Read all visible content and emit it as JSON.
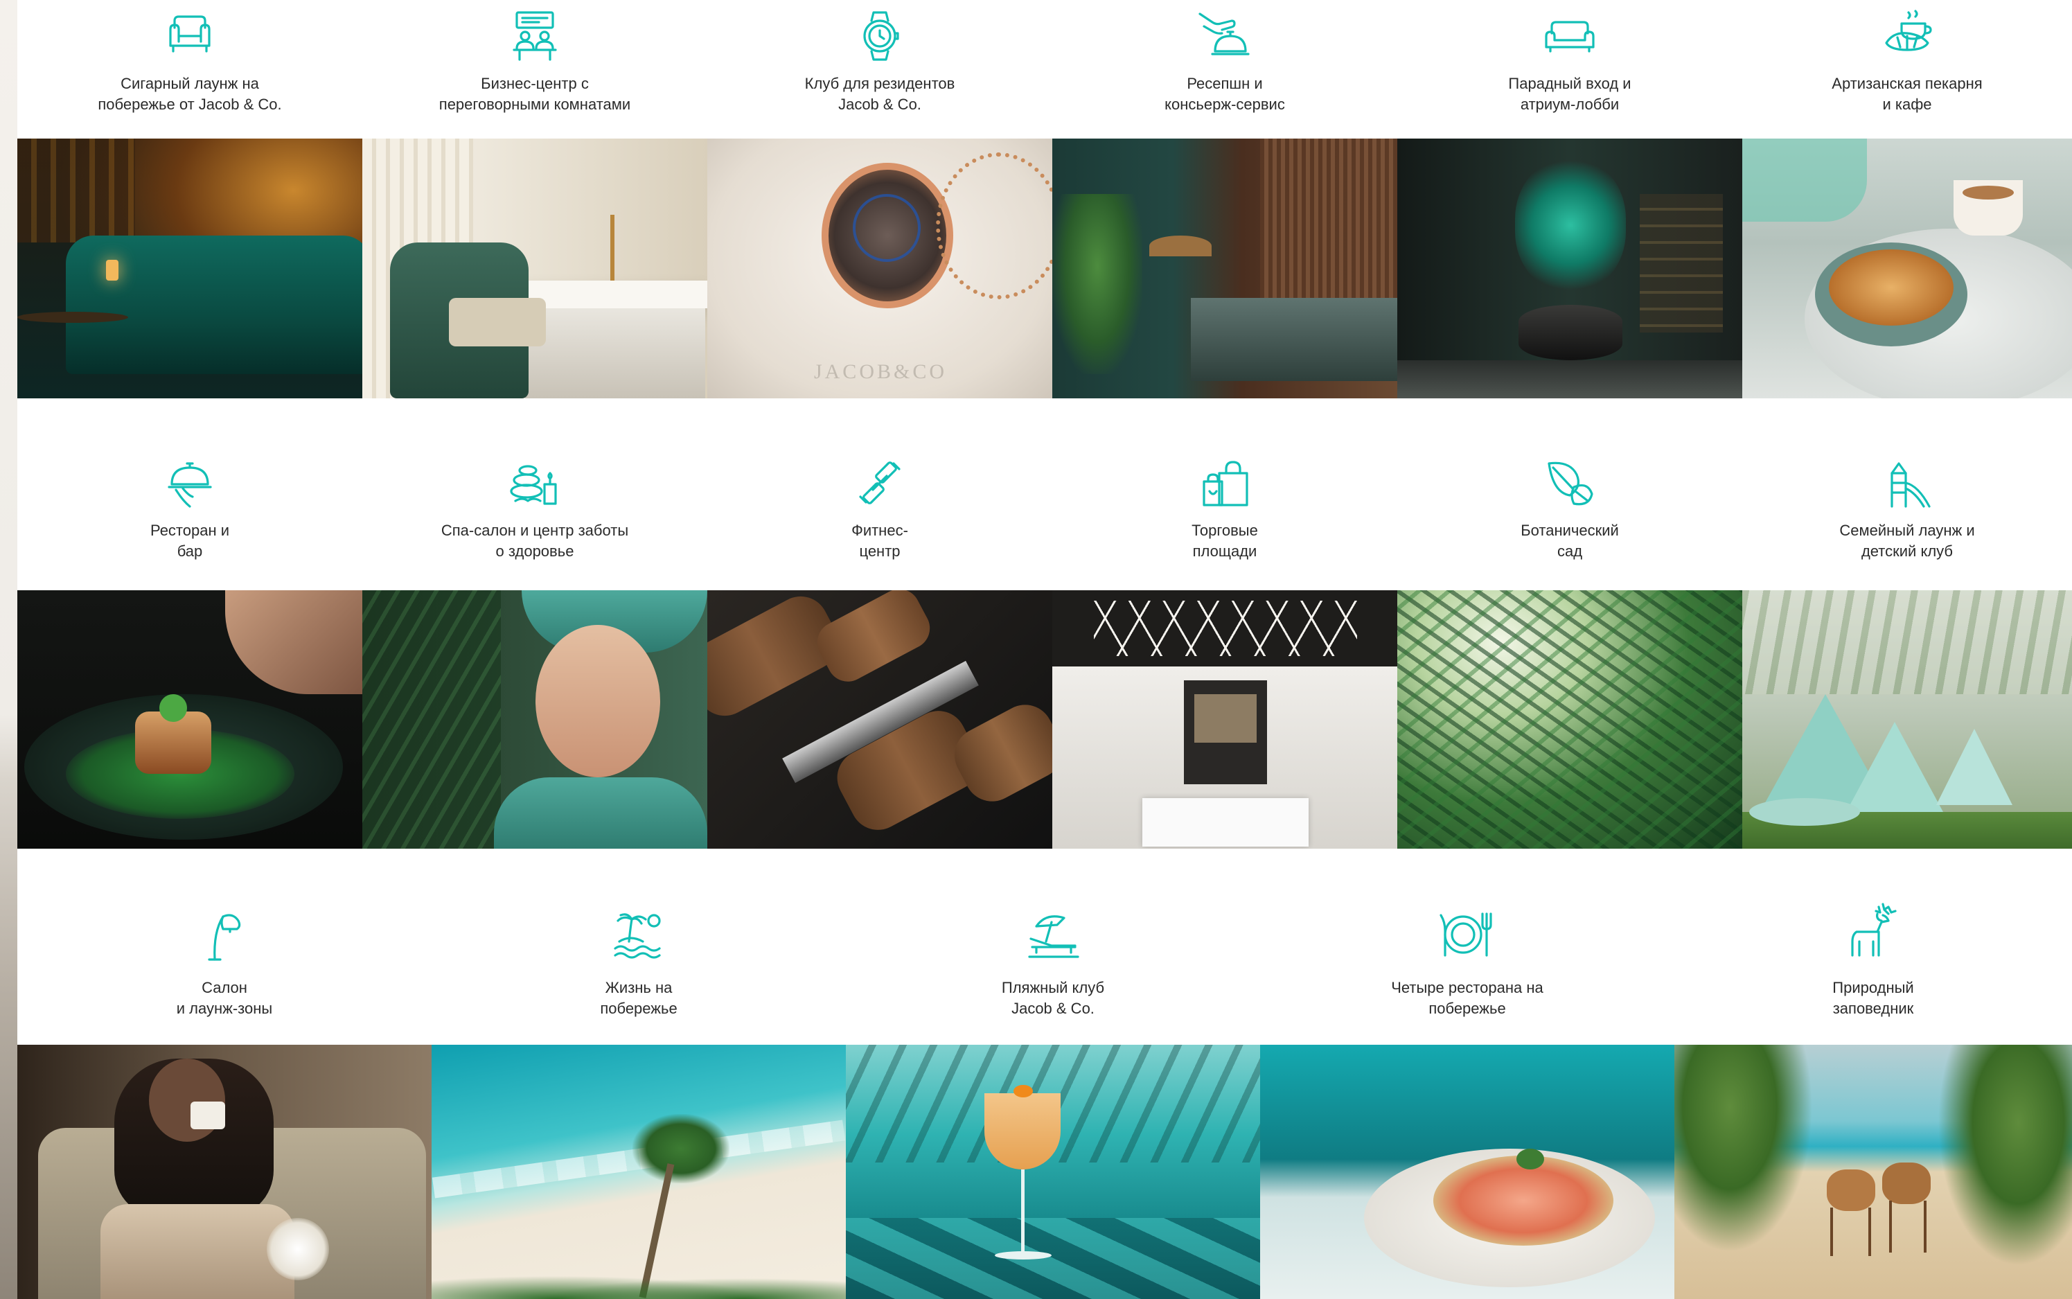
{
  "accent_color": "#12bfb6",
  "rows": [
    {
      "features": [
        {
          "label": "Сигарный лаунж на\nпобережье от Jacob & Co.",
          "icon": "armchair-icon",
          "photo": "cigar-lounge-photo"
        },
        {
          "label": "Бизнес-центр с\nпереговорными комнатами",
          "icon": "meeting-room-icon",
          "photo": "business-center-photo"
        },
        {
          "label": "Клуб для резидентов\nJacob & Co.",
          "icon": "wristwatch-icon",
          "photo": "pocket-watch-photo"
        },
        {
          "label": "Ресепшн и\nконсьерж-сервис",
          "icon": "concierge-bell-icon",
          "photo": "reception-photo"
        },
        {
          "label": "Парадный вход и\nатриум-лобби",
          "icon": "sofa-icon",
          "photo": "atrium-lobby-photo"
        },
        {
          "label": "Артизанская пекарня\nи кафе",
          "icon": "croissant-coffee-icon",
          "photo": "bakery-cafe-photo"
        }
      ]
    },
    {
      "features": [
        {
          "label": "Ресторан и\nбар",
          "icon": "cloche-icon",
          "photo": "restaurant-dish-photo"
        },
        {
          "label": "Спа-салон и центр заботы\nо здоровье",
          "icon": "spa-stones-icon",
          "photo": "spa-woman-photo"
        },
        {
          "label": "Фитнес-\nцентр",
          "icon": "dumbbell-icon",
          "photo": "dumbbells-photo"
        },
        {
          "label": "Торговые\nплощади",
          "icon": "shopping-bags-icon",
          "photo": "retail-showroom-photo"
        },
        {
          "label": "Ботанический\nсад",
          "icon": "leaf-icon",
          "photo": "palm-leaf-photo"
        },
        {
          "label": "Семейный лаунж и\nдетский клуб",
          "icon": "playground-icon",
          "photo": "kids-club-photo"
        }
      ]
    },
    {
      "features": [
        {
          "label": "Салон\nи лаунж-зоны",
          "icon": "floor-lamp-icon",
          "photo": "lounge-woman-photo"
        },
        {
          "label": "Жизнь на\nпобережье",
          "icon": "island-sunset-icon",
          "photo": "beach-aerial-photo"
        },
        {
          "label": "Пляжный клуб\nJacob & Co.",
          "icon": "beach-lounger-icon",
          "photo": "cocktail-photo"
        },
        {
          "label": "Четыре ресторана на\nпобережье",
          "icon": "plate-cutlery-icon",
          "photo": "seafood-plate-photo"
        },
        {
          "label": "Природный\nзаповедник",
          "icon": "deer-icon",
          "photo": "gazelles-photo"
        }
      ]
    }
  ]
}
